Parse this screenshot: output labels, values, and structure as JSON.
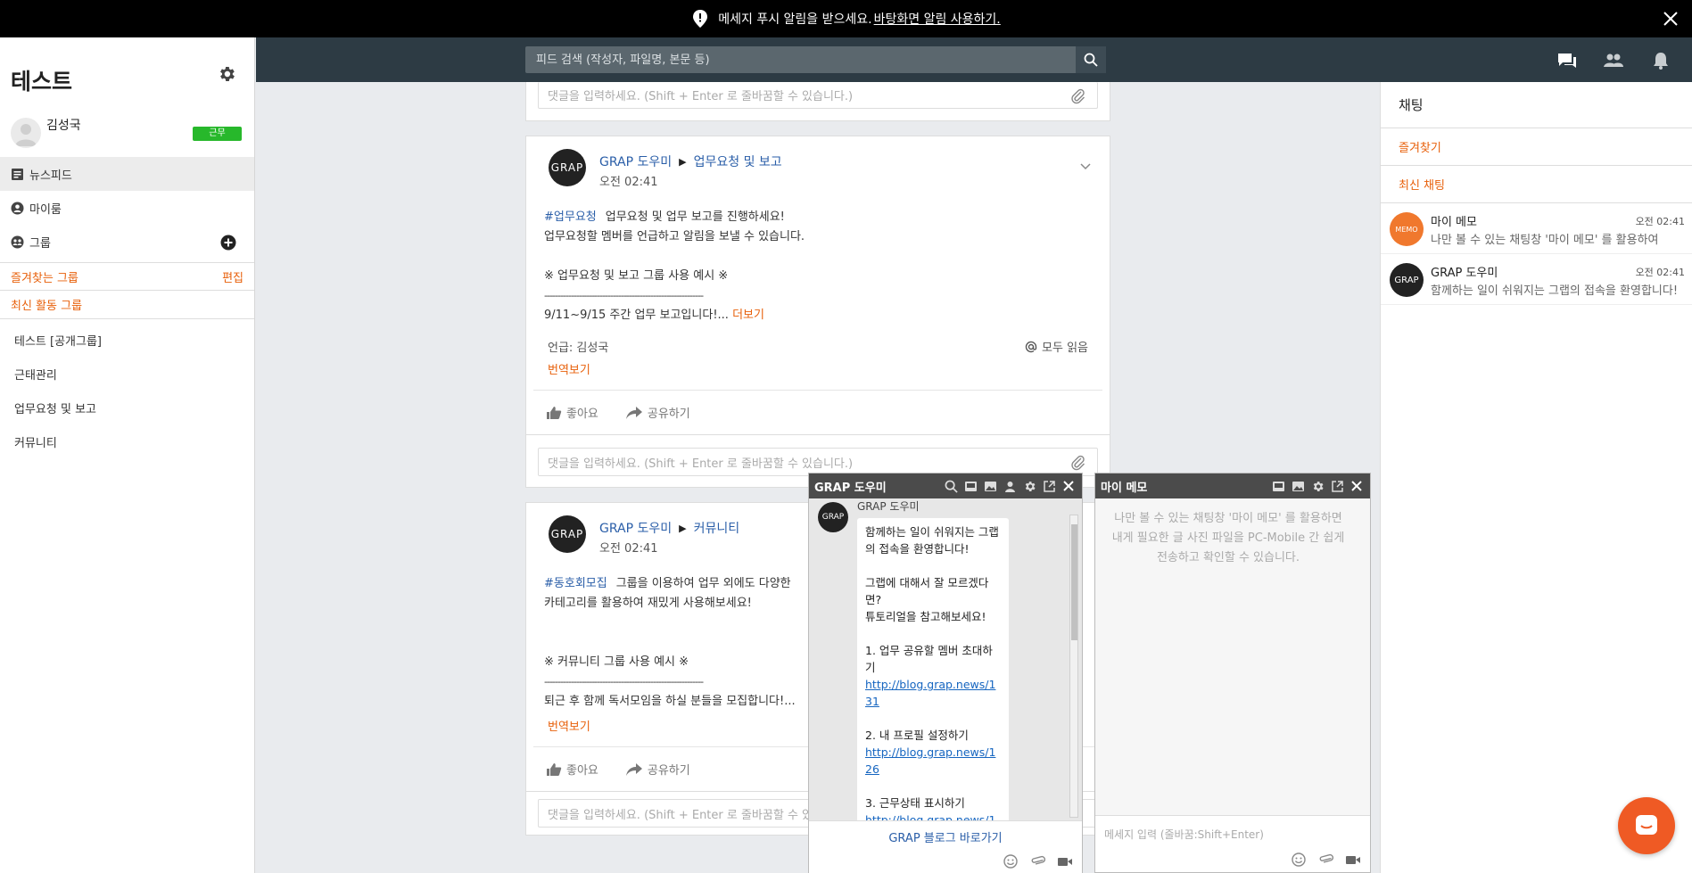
{
  "banner": {
    "text": "메세지 푸시 알림을 받으세요.",
    "link": "바탕화면 알림 사용하기."
  },
  "sidebar": {
    "workspace_title": "테스트",
    "user_name": "김성국",
    "status": "근무",
    "nav": [
      {
        "label": "뉴스피드",
        "icon": "newsfeed-icon"
      },
      {
        "label": "마이룸",
        "icon": "user-icon"
      },
      {
        "label": "그룹",
        "icon": "group-icon"
      }
    ],
    "favorites_label": "즐겨찾는 그룹",
    "edit_label": "편집",
    "recent_label": "최신 활동 그룹",
    "groups": [
      "테스트 [공개그룹]",
      "근태관리",
      "업무요청 및 보고",
      "커뮤니티"
    ]
  },
  "header": {
    "search_placeholder": "피드 검색 (작성자, 파일명, 본문 등)"
  },
  "feed": {
    "comment_placeholder": "댓글을 입력하세요. (Shift + Enter 로 줄바꿈할 수 있습니다.)",
    "comment_placeholder_short": "댓글을 입력하세요. (Shift + Enter 로 줄바꿈할 수 있",
    "posts": [
      {
        "avatar": "GRAP",
        "author": "GRAP 도우미",
        "group": "업무요청 및 보고",
        "time": "오전 02:41",
        "hashtag": "#업무요청",
        "line1": "업무요청 및 업무 보고를 진행하세요!",
        "line2": "업무요청할 멤버를 언급하고 알림을 보낼 수 있습니다.",
        "example_title": "※ 업무요청 및 보고 그룹 사용 예시 ※",
        "divider": "------------------------------------------------------------",
        "excerpt": "9/11~9/15 주간 업무 보고입니다!...",
        "more": "더보기",
        "mention": "언급: 김성국",
        "all_read": "모두 읽음",
        "translate": "번역보기",
        "like": "좋아요",
        "share": "공유하기"
      },
      {
        "avatar": "GRAP",
        "author": "GRAP 도우미",
        "group": "커뮤니티",
        "time": "오전 02:41",
        "hashtag": "#동호회모집",
        "line1": "그룹을 이용하여 업무 외에도 다양한",
        "line2": "카테고리를 활용하여 재밌게 사용해보세요!",
        "example_title": "※ 커뮤니티 그룹 사용 예시 ※",
        "divider": "------------------------------------------------------------",
        "excerpt": "퇴근 후 함께 독서모임을 하실 분들을 모집합니다!...",
        "translate": "번역보기",
        "like": "좋아요",
        "share": "공유하기"
      }
    ]
  },
  "chat_panel": {
    "title": "채팅",
    "favorites": "즐겨찾기",
    "recent": "최신 채팅",
    "items": [
      {
        "name": "마이 메모",
        "time": "오전 02:41",
        "preview": "나만 볼 수 있는 채팅창 '마이 메모' 를 활용하여",
        "avatar": "MEMO",
        "color": "#f0782d"
      },
      {
        "name": "GRAP 도우미",
        "time": "오전 02:41",
        "preview": "함께하는 일이 쉬워지는 그랩의 접속을 환영합니다!",
        "avatar": "GRAP",
        "color": "#222222"
      }
    ]
  },
  "chat_window_grap": {
    "title": "GRAP 도우미",
    "sender": "GRAP 도우미",
    "avatar": "GRAP",
    "p1": "함께하는 일이 쉬워지는 그랩의 접속을 환영합니다!",
    "p2a": "그랩에 대해서 잘 모르겠다면?",
    "p2b": "튜토리얼을 참고해보세요!",
    "item1": "1. 업무 공유할 멤버 초대하기",
    "link1": "http://blog.grap.news/131",
    "item2": "2. 내 프로필 설정하기",
    "link2": "http://blog.grap.news/126",
    "item3": "3. 근무상태 표시하기",
    "link3": "http://blog.grap.news/1",
    "blog_link": "GRAP 블로그 바로가기"
  },
  "chat_window_memo": {
    "title": "마이 메모",
    "hint": "나만 볼 수 있는 채팅창 '마이 메모' 를 활용하면 내게 필요한 글 사진 파일을 PC-Mobile 간 쉽게 전송하고 확인할 수 있습니다.",
    "input_placeholder": "메세지 입력 (줄바꿈:Shift+Enter)"
  }
}
